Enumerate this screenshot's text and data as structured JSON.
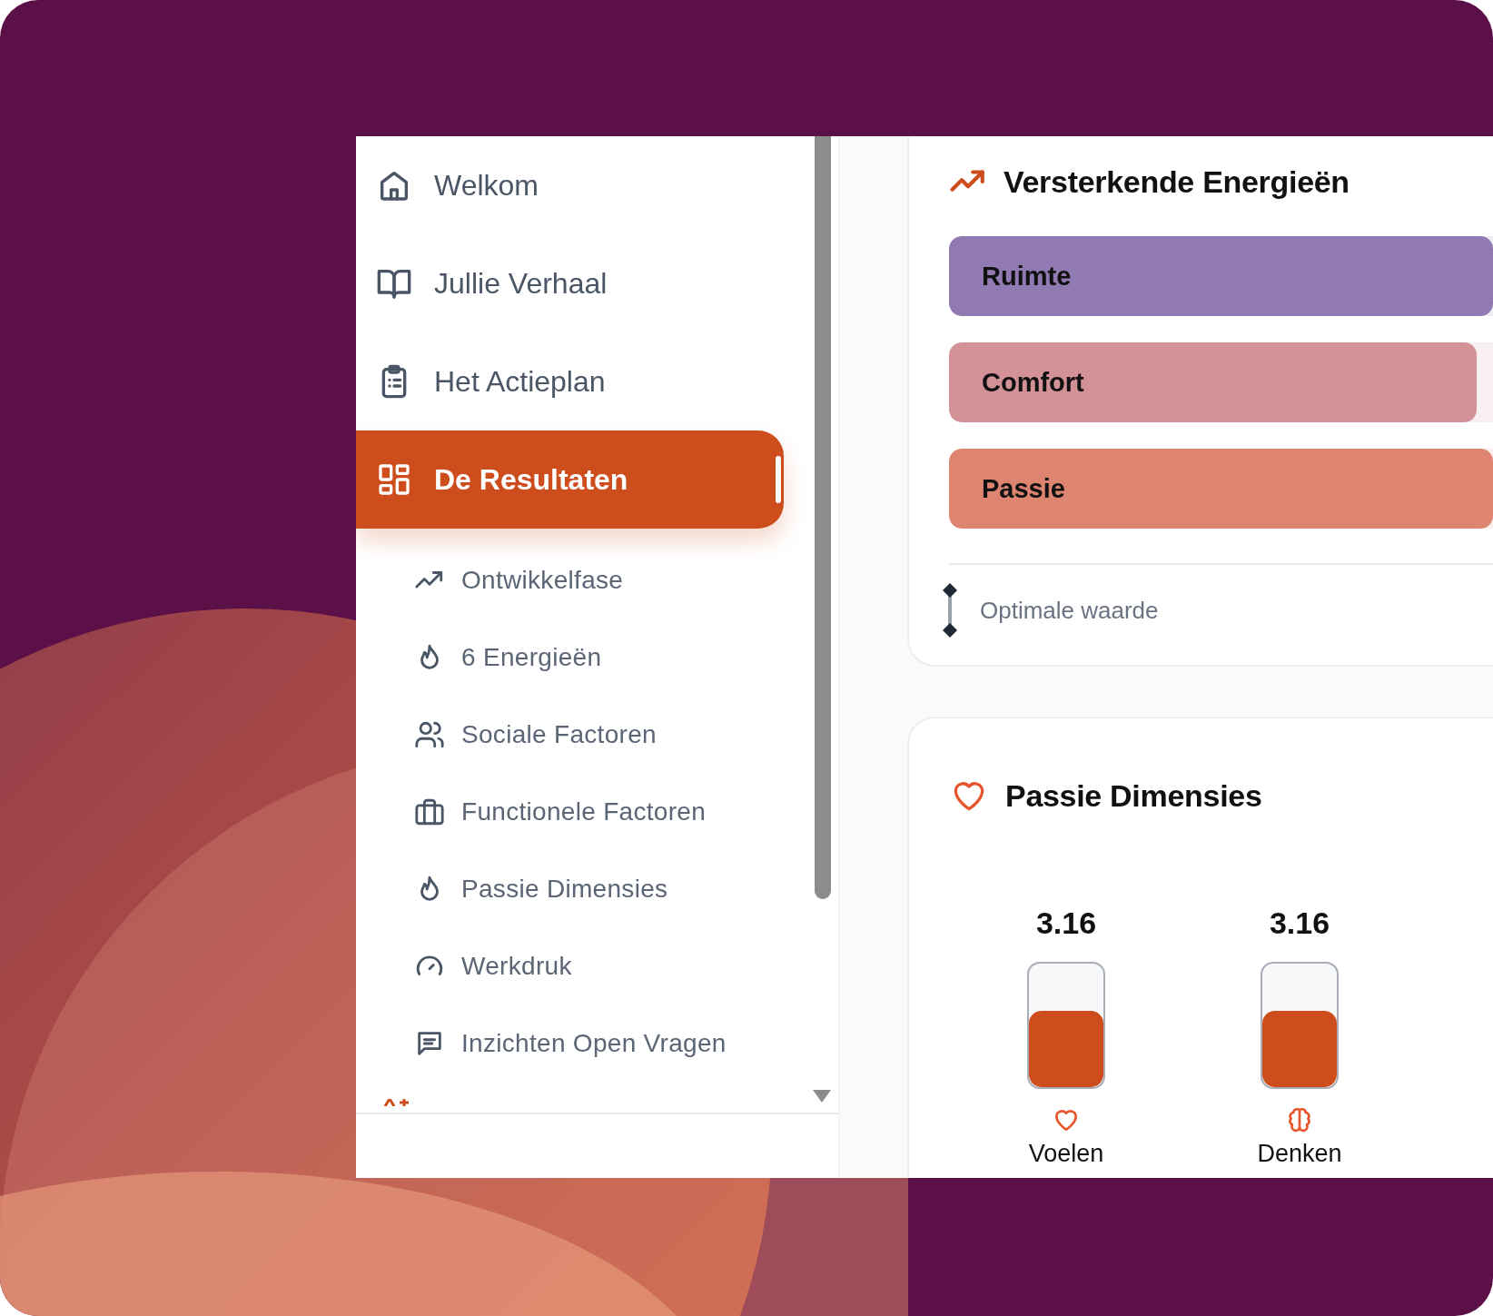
{
  "sidebar": {
    "items": [
      {
        "label": "Welkom",
        "selected": false
      },
      {
        "label": "Jullie Verhaal",
        "selected": false
      },
      {
        "label": "Het Actieplan",
        "selected": false
      },
      {
        "label": "De Resultaten",
        "selected": true,
        "children": [
          {
            "label": "Ontwikkelfase",
            "selected": false
          },
          {
            "label": "6 Energieën",
            "selected": false
          },
          {
            "label": "Sociale Factoren",
            "selected": false
          },
          {
            "label": "Functionele Factoren",
            "selected": false
          },
          {
            "label": "Passie Dimensies",
            "selected": false
          },
          {
            "label": "Werkdruk",
            "selected": false
          },
          {
            "label": "Inzichten Open Vragen",
            "selected": false
          }
        ]
      }
    ]
  },
  "energies_card": {
    "title": "Versterkende Energieën",
    "bars": [
      {
        "label": "Ruimte",
        "color": "#9179b1",
        "level": 1
      },
      {
        "label": "Comfort",
        "color": "#d39298",
        "level": 0.97
      },
      {
        "label": "Passie",
        "color": "#dd8570",
        "level": 1
      }
    ],
    "legend": "Optimale waarde"
  },
  "passion_card": {
    "title": "Passie Dimensies",
    "meters": [
      {
        "value": "3.16",
        "level": 0.62,
        "label": "Voelen"
      },
      {
        "value": "3.16",
        "level": 0.62,
        "label": "Denken"
      }
    ]
  }
}
